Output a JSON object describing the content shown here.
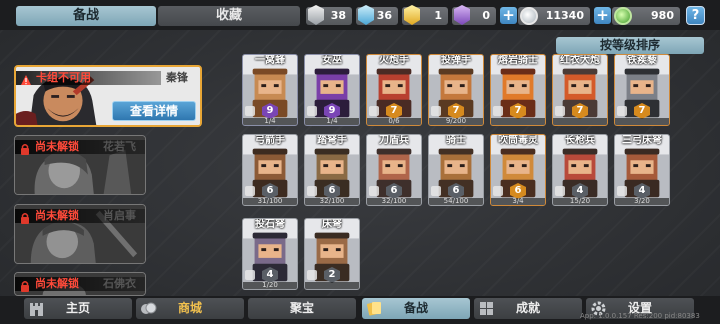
{
  "top_tabs": {
    "active": "备战",
    "inactive": "收藏"
  },
  "resources": {
    "silver_shards": "38",
    "blue_shards": "36",
    "gold_shards": "1",
    "purple_shards": "0",
    "coins": "11340",
    "gems": "980"
  },
  "help_label": "?",
  "sort_button": "按等级排序",
  "heroes": [
    {
      "status": "卡组不可用",
      "name": "秦锋",
      "detail_button": "查看详情"
    },
    {
      "status": "尚未解锁",
      "name": "花若飞"
    },
    {
      "status": "尚未解锁",
      "name": "肖启事"
    },
    {
      "status": "尚未解锁",
      "name": "石佛衣"
    }
  ],
  "units": [
    {
      "name": "一窝蜂",
      "level": "9",
      "progress": "1/4"
    },
    {
      "name": "女巫",
      "level": "9",
      "progress": "1/4"
    },
    {
      "name": "火炮手",
      "level": "7",
      "progress": "0/6"
    },
    {
      "name": "投弹手",
      "level": "7",
      "progress": "9/200"
    },
    {
      "name": "熔岩骑士",
      "level": "7",
      "progress": ""
    },
    {
      "name": "红衣大炮",
      "level": "7",
      "progress": ""
    },
    {
      "name": "铁蒺藜",
      "level": "7",
      "progress": ""
    },
    {
      "name": "弓箭手",
      "level": "6",
      "progress": "31/100"
    },
    {
      "name": "踏弩手",
      "level": "6",
      "progress": "32/100"
    },
    {
      "name": "刀盾兵",
      "level": "6",
      "progress": "32/100"
    },
    {
      "name": "骑士",
      "level": "6",
      "progress": "54/100"
    },
    {
      "name": "吹筒毒灵",
      "level": "6",
      "progress": "3/4"
    },
    {
      "name": "长枪兵",
      "level": "4",
      "progress": "15/20"
    },
    {
      "name": "三弓床弩",
      "level": "4",
      "progress": "3/20"
    },
    {
      "name": "投石弩",
      "level": "4",
      "progress": "1/20"
    },
    {
      "name": "床弩",
      "level": "2",
      "progress": ""
    }
  ],
  "nav": [
    {
      "label": "主页"
    },
    {
      "label": "商城"
    },
    {
      "label": "聚宝"
    },
    {
      "label": "备战"
    },
    {
      "label": "成就"
    },
    {
      "label": "设置"
    }
  ],
  "version_text": "App: 1.0.0.157  Res:200  pid:80383"
}
